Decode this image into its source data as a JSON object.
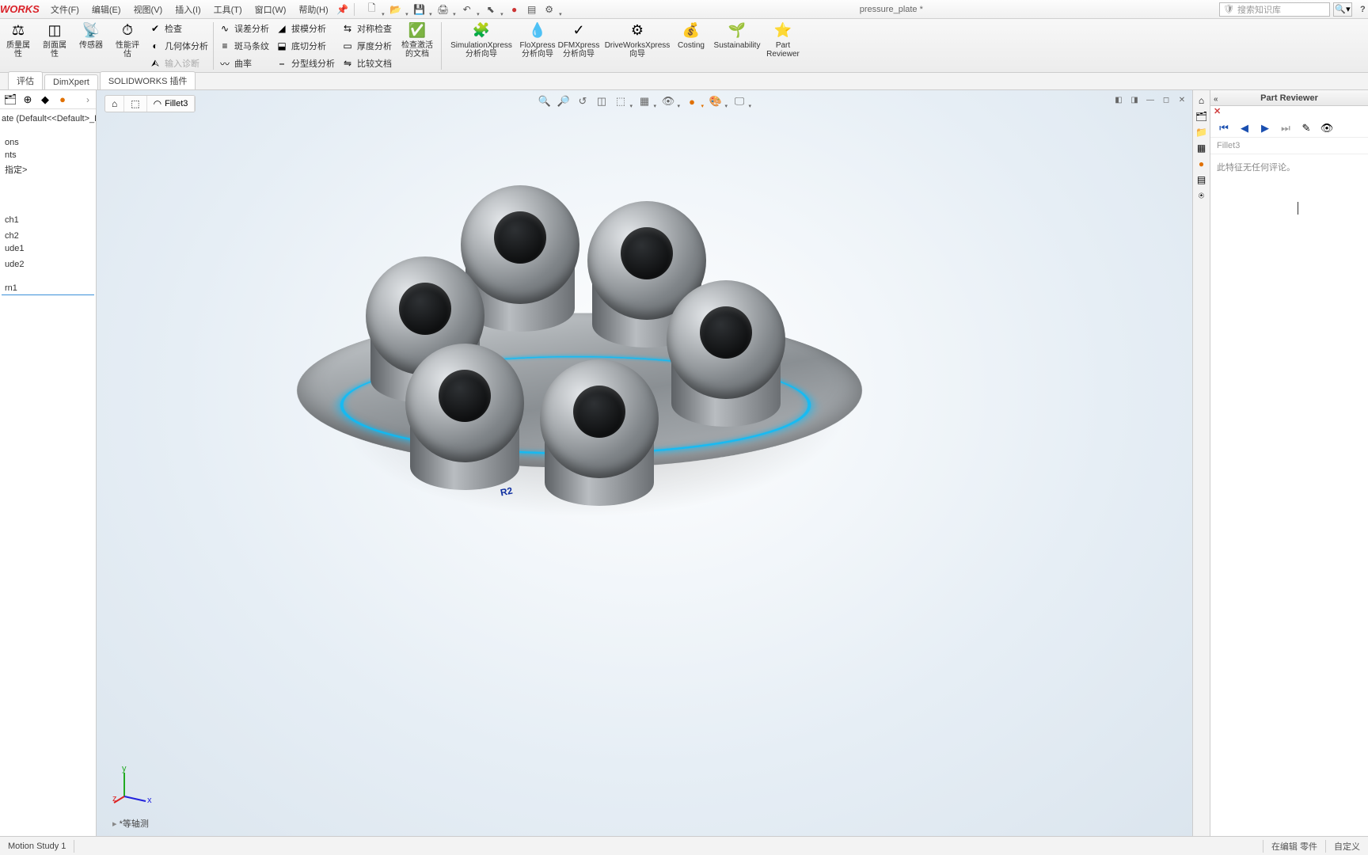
{
  "app": {
    "logo": "WORKS",
    "title": "pressure_plate *"
  },
  "menu": {
    "file": "文件(F)",
    "edit": "编辑(E)",
    "view": "视图(V)",
    "insert": "插入(I)",
    "tools": "工具(T)",
    "window": "窗口(W)",
    "help": "帮助(H)"
  },
  "search": {
    "placeholder": "搜索知识库"
  },
  "ribbon": {
    "big": {
      "mass": "质量属\n性",
      "section": "剖面属\n性",
      "sensor": "传感器",
      "perf": "性能评\n估",
      "checkdoc": "检查激活\n的文档",
      "simx": "SimulationXpress\n分析向导",
      "flox": "FloXpress\n分析向导",
      "dfmx": "DFMXpress\n分析向导",
      "drvx": "DriveWorksXpress\n向导",
      "costing": "Costing",
      "sustain": "Sustainability",
      "partrev": "Part\nReviewer"
    },
    "small": {
      "check": "检查",
      "geom": "几何体分析",
      "diag": "输入诊断",
      "dev": "误差分析",
      "zebra": "斑马条纹",
      "curv": "曲率",
      "draft": "拔模分析",
      "undercut": "底切分析",
      "parting": "分型线分析",
      "sym": "对称检查",
      "thick": "厚度分析",
      "compare": "比较文档"
    }
  },
  "tabs": {
    "eval": "评估",
    "dimx": "DimXpert",
    "plugins": "SOLIDWORKS 插件"
  },
  "breadcrumb": {
    "feature": "Fillet3"
  },
  "tree": {
    "root": "ate  (Default<<Default>_P",
    "items": [
      "ons",
      "nts",
      "指定>",
      "",
      "ch1",
      "",
      "ch2",
      "ude1",
      "",
      "ude2",
      "rn1"
    ]
  },
  "orient": "*等轴测",
  "callout": "R2",
  "reviewer": {
    "title": "Part Reviewer",
    "feature": "Fillet3",
    "comment": "此特征无任何评论。"
  },
  "status": {
    "motion": "Motion Study 1",
    "editing": "在编辑 零件",
    "custom": "自定义"
  }
}
